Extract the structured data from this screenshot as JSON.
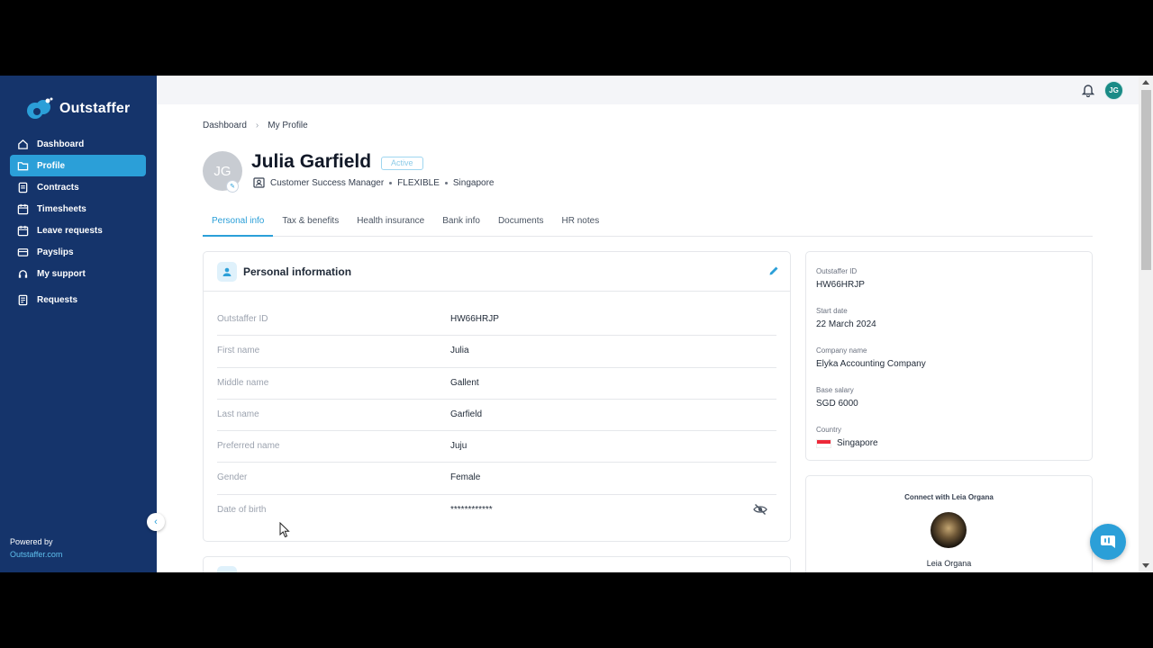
{
  "brand": {
    "name": "Outstaffer",
    "accent": "#2b9fd8",
    "sidebar_bg": "#15346b"
  },
  "sidebar": {
    "items": [
      {
        "label": "Dashboard",
        "icon": "home-icon",
        "active": false
      },
      {
        "label": "Profile",
        "icon": "folder-icon",
        "active": true
      },
      {
        "label": "Contracts",
        "icon": "contract-icon",
        "active": false
      },
      {
        "label": "Timesheets",
        "icon": "calendar-icon",
        "active": false
      },
      {
        "label": "Leave requests",
        "icon": "calendar-icon",
        "active": false
      },
      {
        "label": "Payslips",
        "icon": "payslip-icon",
        "active": false
      },
      {
        "label": "My support",
        "icon": "support-icon",
        "active": false
      },
      {
        "label": "Requests",
        "icon": "requests-icon",
        "active": false
      }
    ],
    "powered_by": "Powered by",
    "powered_link": "Outstaffer.com"
  },
  "topbar": {
    "avatar_initials": "JG",
    "bell_icon": "bell-icon"
  },
  "breadcrumb": {
    "root": "Dashboard",
    "current": "My Profile"
  },
  "profile": {
    "initials": "JG",
    "name": "Julia Garfield",
    "status": "Active",
    "role": "Customer Success Manager",
    "employment_type": "FLEXIBLE",
    "location": "Singapore"
  },
  "tabs": [
    {
      "label": "Personal info",
      "active": true
    },
    {
      "label": "Tax & benefits",
      "active": false
    },
    {
      "label": "Health insurance",
      "active": false
    },
    {
      "label": "Bank info",
      "active": false
    },
    {
      "label": "Documents",
      "active": false
    },
    {
      "label": "HR notes",
      "active": false
    }
  ],
  "personal_info": {
    "title": "Personal information",
    "rows": [
      {
        "label": "Outstaffer ID",
        "value": "HW66HRJP"
      },
      {
        "label": "First name",
        "value": "Julia"
      },
      {
        "label": "Middle name",
        "value": "Gallent"
      },
      {
        "label": "Last name",
        "value": "Garfield"
      },
      {
        "label": "Preferred name",
        "value": "Juju"
      },
      {
        "label": "Gender",
        "value": "Female"
      },
      {
        "label": "Date of birth",
        "value": "************"
      }
    ]
  },
  "summary": {
    "items": [
      {
        "label": "Outstaffer ID",
        "value": "HW66HRJP"
      },
      {
        "label": "Start date",
        "value": "22 March 2024"
      },
      {
        "label": "Company name",
        "value": "Elyka Accounting Company"
      },
      {
        "label": "Base salary",
        "value": "SGD 6000"
      },
      {
        "label": "Country",
        "value": "Singapore"
      }
    ]
  },
  "connect": {
    "title": "Connect with Leia Organa",
    "name": "Leia Organa"
  }
}
